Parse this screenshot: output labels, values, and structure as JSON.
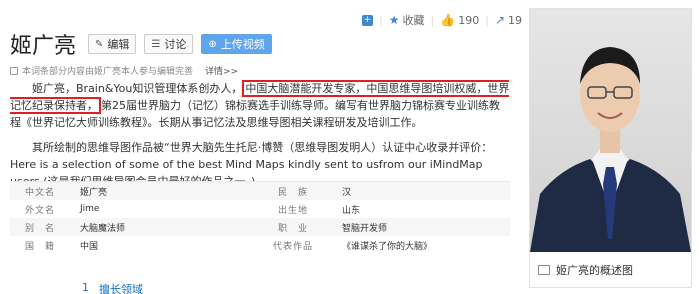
{
  "actions": {
    "collect_label": "收藏",
    "like_count": "190",
    "share_count": "19"
  },
  "title": "姬广亮",
  "buttons": {
    "edit": "编辑",
    "discuss": "讨论",
    "upload_video": "上传视频"
  },
  "note": {
    "text": "本词条部分内容由姬广亮本人参与编辑完善",
    "more": "详情>>"
  },
  "para1": {
    "a": "姬广亮，Brain&You知识管理体系创办人，",
    "highlight": "中国大脑潜能开发专家，中国思维导图培训权威，世界记忆纪录保持者，",
    "b": "第25届世界脑力（记忆）锦标赛选手训练导师。编写有世界脑力锦标赛专业训练教程《世界记忆大师训练教程》。长期从事记忆法及思维导图相关课程研发及培训工作。"
  },
  "para2": {
    "text": "其所绘制的思维导图作品被“世界大脑先生托尼·博赞（思维导图发明人）认证中心收录并评价：Here is a selection of some of the best Mind Maps kindly sent to usfrom our iMindMap users.(这是我们思维导图会员中最好的作品之一。)"
  },
  "info": [
    {
      "k1": "中文名",
      "v1": "姬广亮",
      "k2": "民　族",
      "v2": "汉"
    },
    {
      "k1": "外文名",
      "v1": "Jime",
      "k2": "出生地",
      "v2": "山东"
    },
    {
      "k1": "别　名",
      "v1": "大脑魔法师",
      "k2": "职　业",
      "v2": "智脑开发师"
    },
    {
      "k1": "国　籍",
      "v1": "中国",
      "k2": "代表作品",
      "v2": "《谁谋杀了你的大脑》"
    }
  ],
  "section": {
    "num": "1",
    "label": "擅长领域"
  },
  "photo": {
    "caption": "姬广亮的概述图"
  }
}
